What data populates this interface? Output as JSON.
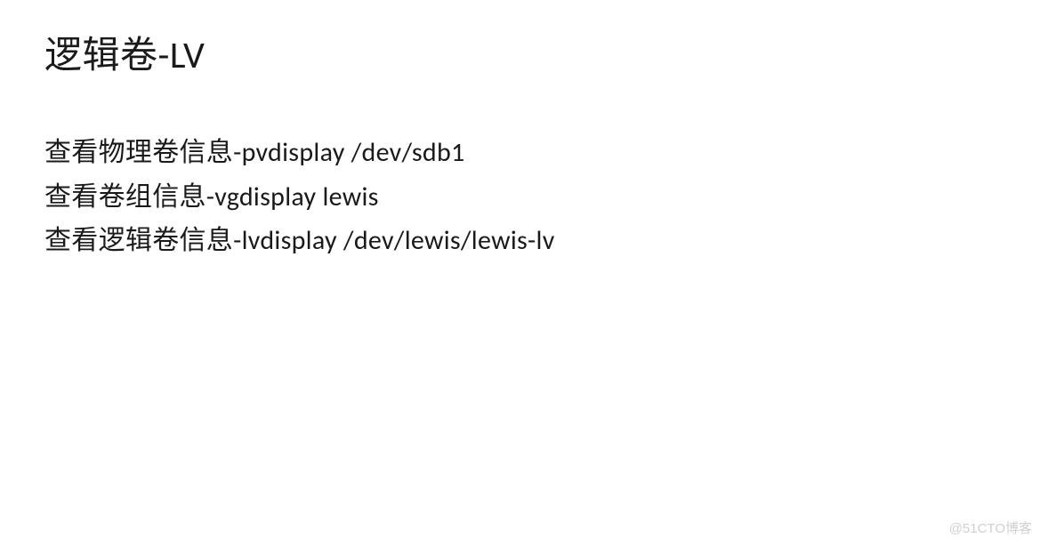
{
  "title": "逻辑卷-LV",
  "lines": [
    "查看物理卷信息-pvdisplay /dev/sdb1",
    "查看卷组信息-vgdisplay lewis",
    "查看逻辑卷信息-lvdisplay /dev/lewis/lewis-lv"
  ],
  "watermark": "@51CTO博客"
}
